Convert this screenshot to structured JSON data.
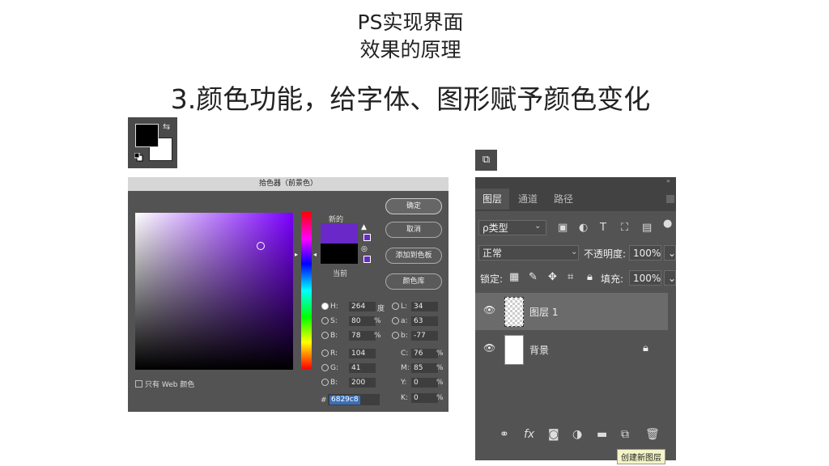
{
  "heading": {
    "line1": "PS实现界面",
    "line2": "效果的原理",
    "subtitle": "3.颜色功能，给字体、图形赋予颜色变化"
  },
  "swatches": {
    "foreground": "#000000",
    "background": "#ffffff",
    "swap_icon": "swap-arrows-icon"
  },
  "picker": {
    "title": "拾色器（前景色）",
    "new_label": "新的",
    "current_label": "当前",
    "new_color": "#6829c8",
    "current_color": "#000000",
    "buttons": {
      "ok": "确定",
      "cancel": "取消",
      "add_swatch": "添加到色板",
      "library": "颜色库"
    },
    "hsb": [
      {
        "label": "H:",
        "value": "264",
        "unit": "度",
        "selected": true
      },
      {
        "label": "S:",
        "value": "80",
        "unit": "%"
      },
      {
        "label": "B:",
        "value": "78",
        "unit": "%"
      }
    ],
    "rgb": [
      {
        "label": "R:",
        "value": "104"
      },
      {
        "label": "G:",
        "value": "41"
      },
      {
        "label": "B:",
        "value": "200"
      }
    ],
    "lab": [
      {
        "label": "L:",
        "value": "34"
      },
      {
        "label": "a:",
        "value": "63"
      },
      {
        "label": "b:",
        "value": "-77"
      }
    ],
    "cmyk": [
      {
        "label": "C:",
        "value": "76",
        "unit": "%"
      },
      {
        "label": "M:",
        "value": "85",
        "unit": "%"
      },
      {
        "label": "Y:",
        "value": "0",
        "unit": "%"
      },
      {
        "label": "K:",
        "value": "0",
        "unit": "%"
      }
    ],
    "hex_label": "#",
    "hex": "6829c8",
    "web_only": "只有 Web 颜色"
  },
  "layers_panel": {
    "new_layer_icon": "new-layer-icon",
    "tabs": [
      "图层",
      "通道",
      "路径"
    ],
    "filter": "ρ类型",
    "blend_mode": "正常",
    "opacity_label": "不透明度:",
    "opacity": "100%",
    "lock_label": "锁定:",
    "fill_label": "填充:",
    "fill": "100%",
    "layers": [
      {
        "name": "图层 1",
        "selected": true
      },
      {
        "name": "背景",
        "locked": true
      }
    ],
    "bottom_icons": [
      "link-icon",
      "fx-icon",
      "mask-icon",
      "adjustment-icon",
      "folder-icon",
      "new-layer-icon",
      "trash-icon"
    ],
    "fx_text": "fx",
    "tooltip": "创建新图层"
  }
}
